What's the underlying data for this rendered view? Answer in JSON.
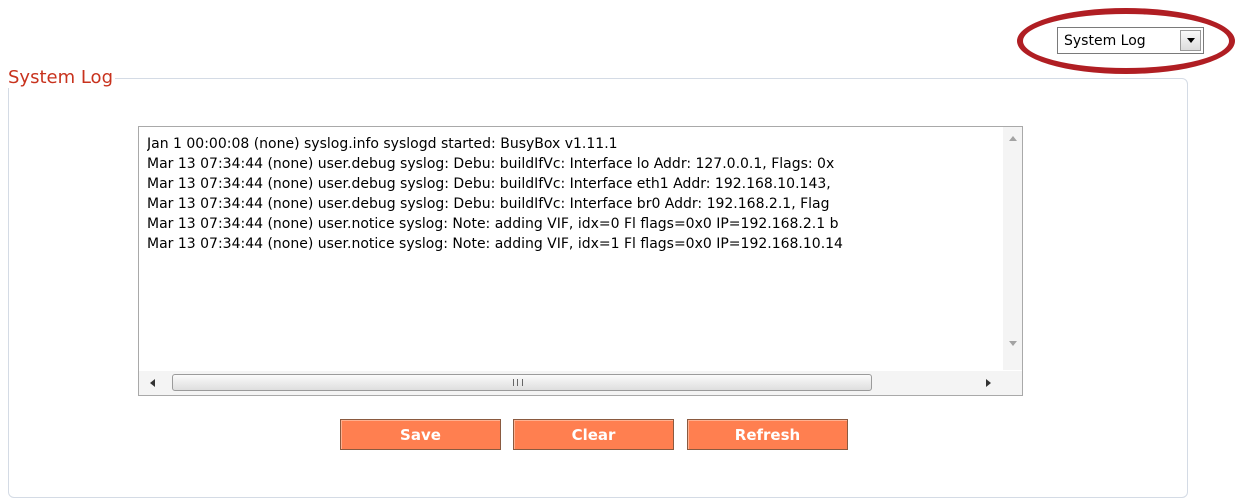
{
  "selector": {
    "selected": "System Log"
  },
  "panel": {
    "title": "System Log"
  },
  "log": {
    "lines": [
      "Jan  1 00:00:08 (none) syslog.info syslogd started: BusyBox v1.11.1",
      "Mar 13 07:34:44 (none) user.debug syslog: Debu: buildIfVc: Interface lo Addr: 127.0.0.1, Flags: 0x",
      "Mar 13 07:34:44 (none) user.debug syslog: Debu: buildIfVc: Interface eth1 Addr: 192.168.10.143,",
      "Mar 13 07:34:44 (none) user.debug syslog: Debu: buildIfVc: Interface br0 Addr: 192.168.2.1, Flag",
      "Mar 13 07:34:44 (none) user.notice syslog: Note: adding VIF, idx=0 Fl flags=0x0 IP=192.168.2.1 b",
      "Mar 13 07:34:44 (none) user.notice syslog: Note: adding VIF, idx=1 Fl flags=0x0 IP=192.168.10.14"
    ]
  },
  "buttons": {
    "save": "Save",
    "clear": "Clear",
    "refresh": "Refresh"
  },
  "colors": {
    "accent": "#ff7f50",
    "title": "#c8321d",
    "highlight": "#b01e23"
  }
}
